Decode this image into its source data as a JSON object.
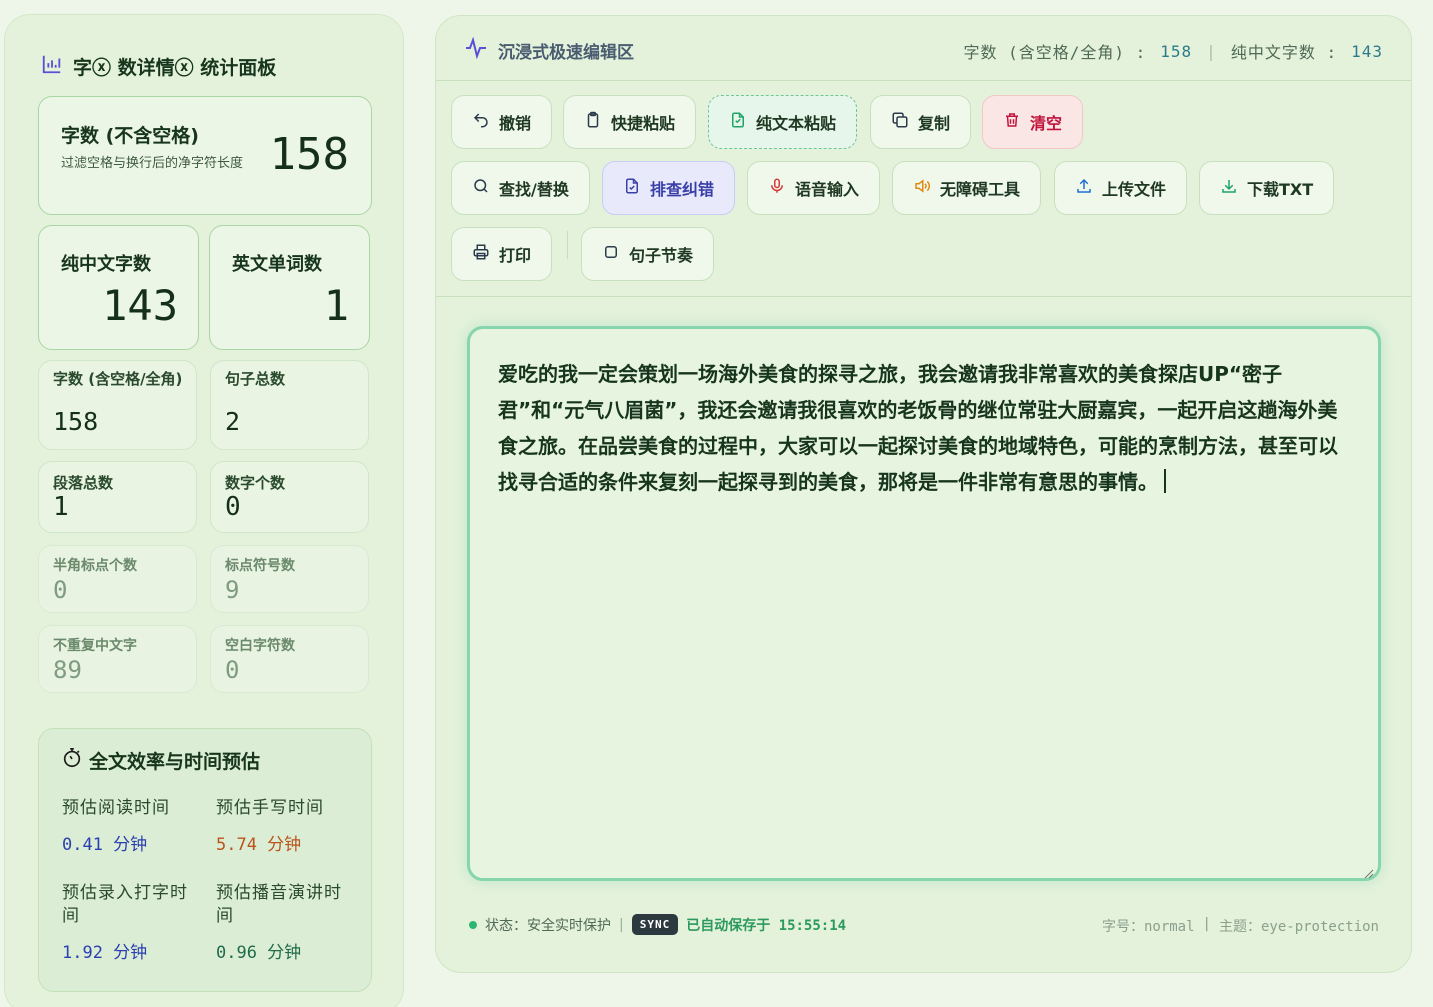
{
  "left": {
    "title": "字ⓧ 数详情ⓧ 统计面板",
    "title_icon": "bar-chart-icon",
    "main_card": {
      "label": "字数 (不含空格)",
      "subtitle": "过滤空格与换行后的净字符长度",
      "value": "158"
    },
    "mid_cards": [
      {
        "label": "纯中文字数",
        "value": "143"
      },
      {
        "label": "英文单词数",
        "value": "1"
      }
    ],
    "small_cards": [
      {
        "label": "字数 (含空格/全角)",
        "value": "158"
      },
      {
        "label": "句子总数",
        "value": "2"
      },
      {
        "label": "段落总数",
        "value": "1"
      },
      {
        "label": "数字个数",
        "value": "0"
      },
      {
        "label": "半角标点个数",
        "value": "0"
      },
      {
        "label": "标点符号数",
        "value": "9"
      },
      {
        "label": "不重复中文字",
        "value": "89"
      },
      {
        "label": "空白字符数",
        "value": "0"
      }
    ],
    "efficiency": {
      "title": "全文效率与时间预估",
      "icon": "stopwatch-icon",
      "items": [
        {
          "label": "预估阅读时间",
          "value": "0.41 分钟"
        },
        {
          "label": "预估手写时间",
          "value": "5.74 分钟"
        },
        {
          "label": "预估录入打字时间",
          "value": "1.92 分钟"
        },
        {
          "label": "预估播音演讲时间",
          "value": "0.96 分钟"
        }
      ]
    }
  },
  "editor_panel": {
    "title": "沉浸式极速编辑区",
    "title_icon": "activity-icon",
    "stats": {
      "full_label": "字数 (含空格/全角) :",
      "full_value": "158",
      "sep": "|",
      "cn_label": "纯中文字数 :",
      "cn_value": "143"
    },
    "toolbar": {
      "undo": "撤销",
      "quick_paste": "快捷粘贴",
      "plain_paste": "纯文本粘贴",
      "copy": "复制",
      "clear": "清空",
      "find_replace": "查找/替换",
      "proofread": "排查纠错",
      "voice_input": "语音输入",
      "accessibility": "无障碍工具",
      "upload": "上传文件",
      "download": "下载TXT",
      "print": "打印",
      "sentence_rhythm": "句子节奏"
    },
    "content": "爱吃的我一定会策划一场海外美食的探寻之旅，我会邀请我非常喜欢的美食探店UP“密子君”和“元气八眉菌”，我还会邀请我很喜欢的老饭骨的继位常驻大厨嘉宾，一起开启这趟海外美食之旅。在品尝美食的过程中，大家可以一起探讨美食的地域特色，可能的烹制方法，甚至可以找寻合适的条件来复刻一起探寻到的美食，那将是一件非常有意思的事情。",
    "footer": {
      "status": "状态：安全实时保护",
      "sep": "|",
      "sync": "SYNC",
      "saved": "已自动保存于 15:55:14",
      "font_label": "字号：normal",
      "theme_label": "主题：eye-protection"
    }
  },
  "colors": {
    "accent_green": "#86d5ad",
    "danger": "#c0143c",
    "active": "#3a3fa8",
    "value_blue": "#2a3fb0",
    "value_orange": "#b9541a"
  }
}
